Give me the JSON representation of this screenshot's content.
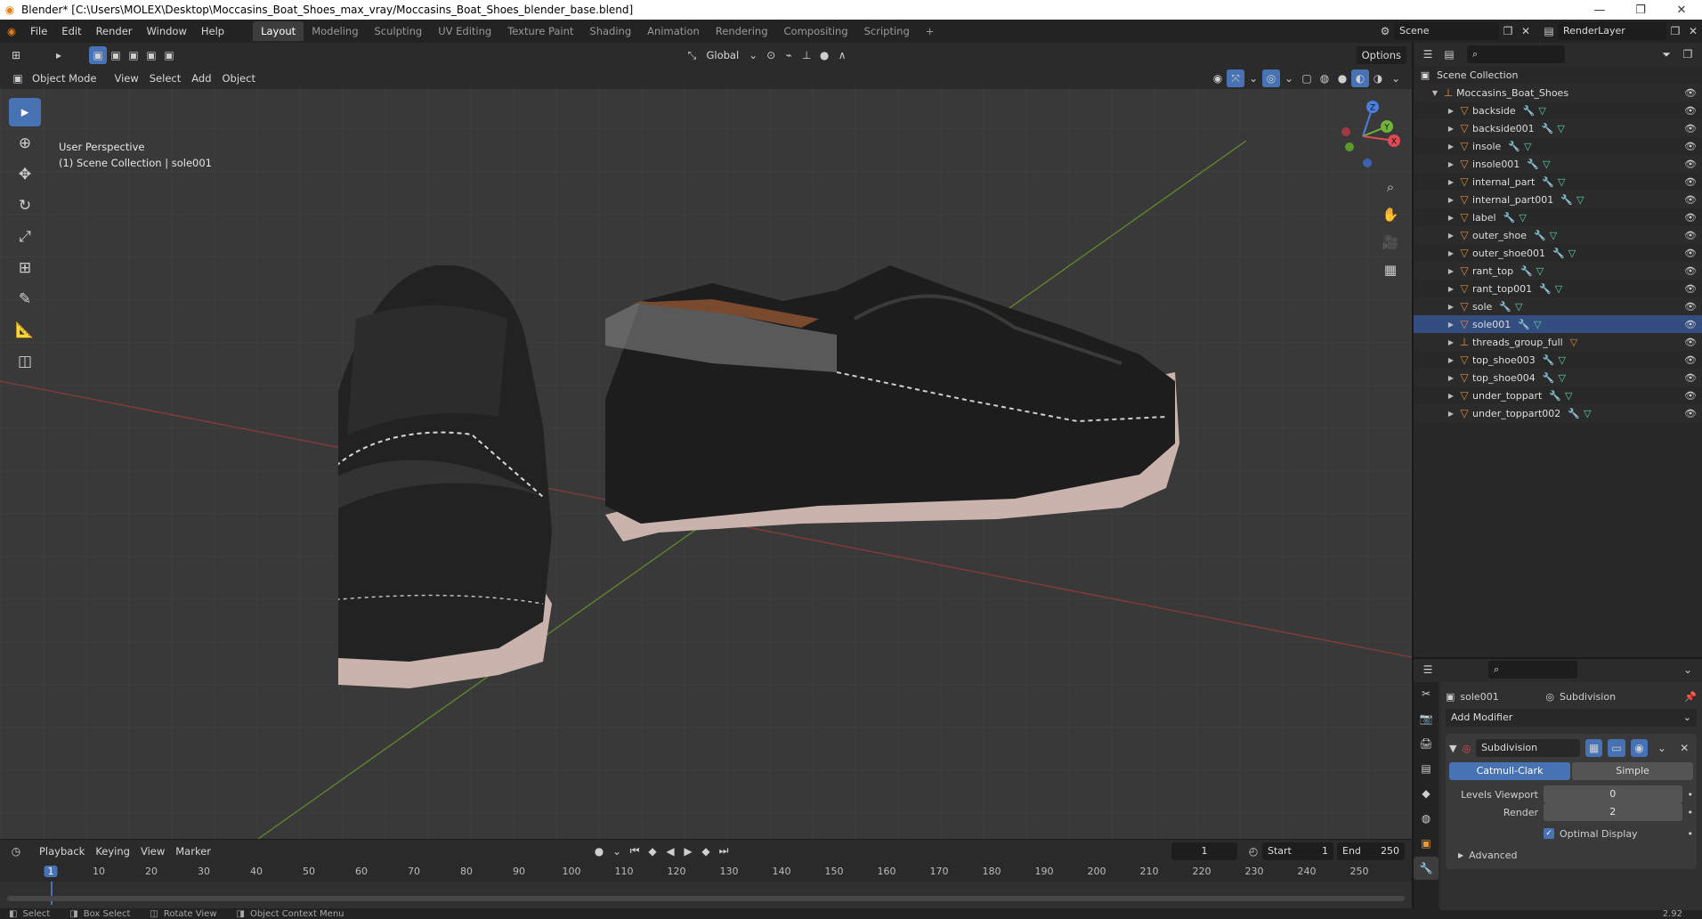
{
  "window": {
    "title": "Blender* [C:\\Users\\MOLEX\\Desktop\\Moccasins_Boat_Shoes_max_vray/Moccasins_Boat_Shoes_blender_base.blend]",
    "minimize": "—",
    "maximize": "❐",
    "close": "✕"
  },
  "menu": [
    "File",
    "Edit",
    "Render",
    "Window",
    "Help"
  ],
  "workspaces": [
    "Layout",
    "Modeling",
    "Sculpting",
    "UV Editing",
    "Texture Paint",
    "Shading",
    "Animation",
    "Rendering",
    "Compositing",
    "Scripting"
  ],
  "active_workspace": "Layout",
  "scene": {
    "name": "Scene",
    "render_layer": "RenderLayer"
  },
  "viewport_header": {
    "transform_orientation": "Global",
    "options_label": "Options",
    "mode": "Object Mode",
    "view_menu": [
      "View",
      "Select",
      "Add",
      "Object"
    ]
  },
  "viewport": {
    "perspective": "User Perspective",
    "collection_info": "(1) Scene Collection | sole001",
    "gizmo": {
      "z": "Z",
      "y": "Y",
      "x": "X"
    }
  },
  "outliner": {
    "root": "Scene Collection",
    "collection": "Moccasins_Boat_Shoes",
    "items": [
      "backside",
      "backside001",
      "insole",
      "insole001",
      "internal_part",
      "internal_part001",
      "label",
      "outer_shoe",
      "outer_shoe001",
      "rant_top",
      "rant_top001",
      "sole",
      "sole001",
      "threads_group_full",
      "top_shoe003",
      "top_shoe004",
      "under_toppart",
      "under_toppart002"
    ],
    "selected": "sole001"
  },
  "properties": {
    "object_name": "sole001",
    "modifier_tab": "Subdivision",
    "add_modifier": "Add Modifier",
    "modifier": {
      "name": "Subdivision",
      "type_options": [
        "Catmull-Clark",
        "Simple"
      ],
      "active_type": "Catmull-Clark",
      "levels_viewport_label": "Levels Viewport",
      "levels_viewport": "0",
      "render_label": "Render",
      "render": "2",
      "optimal_display_label": "Optimal Display",
      "advanced_label": "Advanced"
    }
  },
  "timeline": {
    "menus": [
      "Playback",
      "Keying",
      "View",
      "Marker"
    ],
    "current_frame": "1",
    "start_label": "Start",
    "start": "1",
    "end_label": "End",
    "end": "250",
    "ticks": [
      "1",
      "10",
      "20",
      "30",
      "40",
      "50",
      "60",
      "70",
      "80",
      "90",
      "100",
      "110",
      "120",
      "130",
      "140",
      "150",
      "160",
      "170",
      "180",
      "190",
      "200",
      "210",
      "220",
      "230",
      "240",
      "250"
    ]
  },
  "statusbar": [
    "Select",
    "Box Select",
    "Rotate View",
    "Object Context Menu"
  ],
  "version": "2.92"
}
